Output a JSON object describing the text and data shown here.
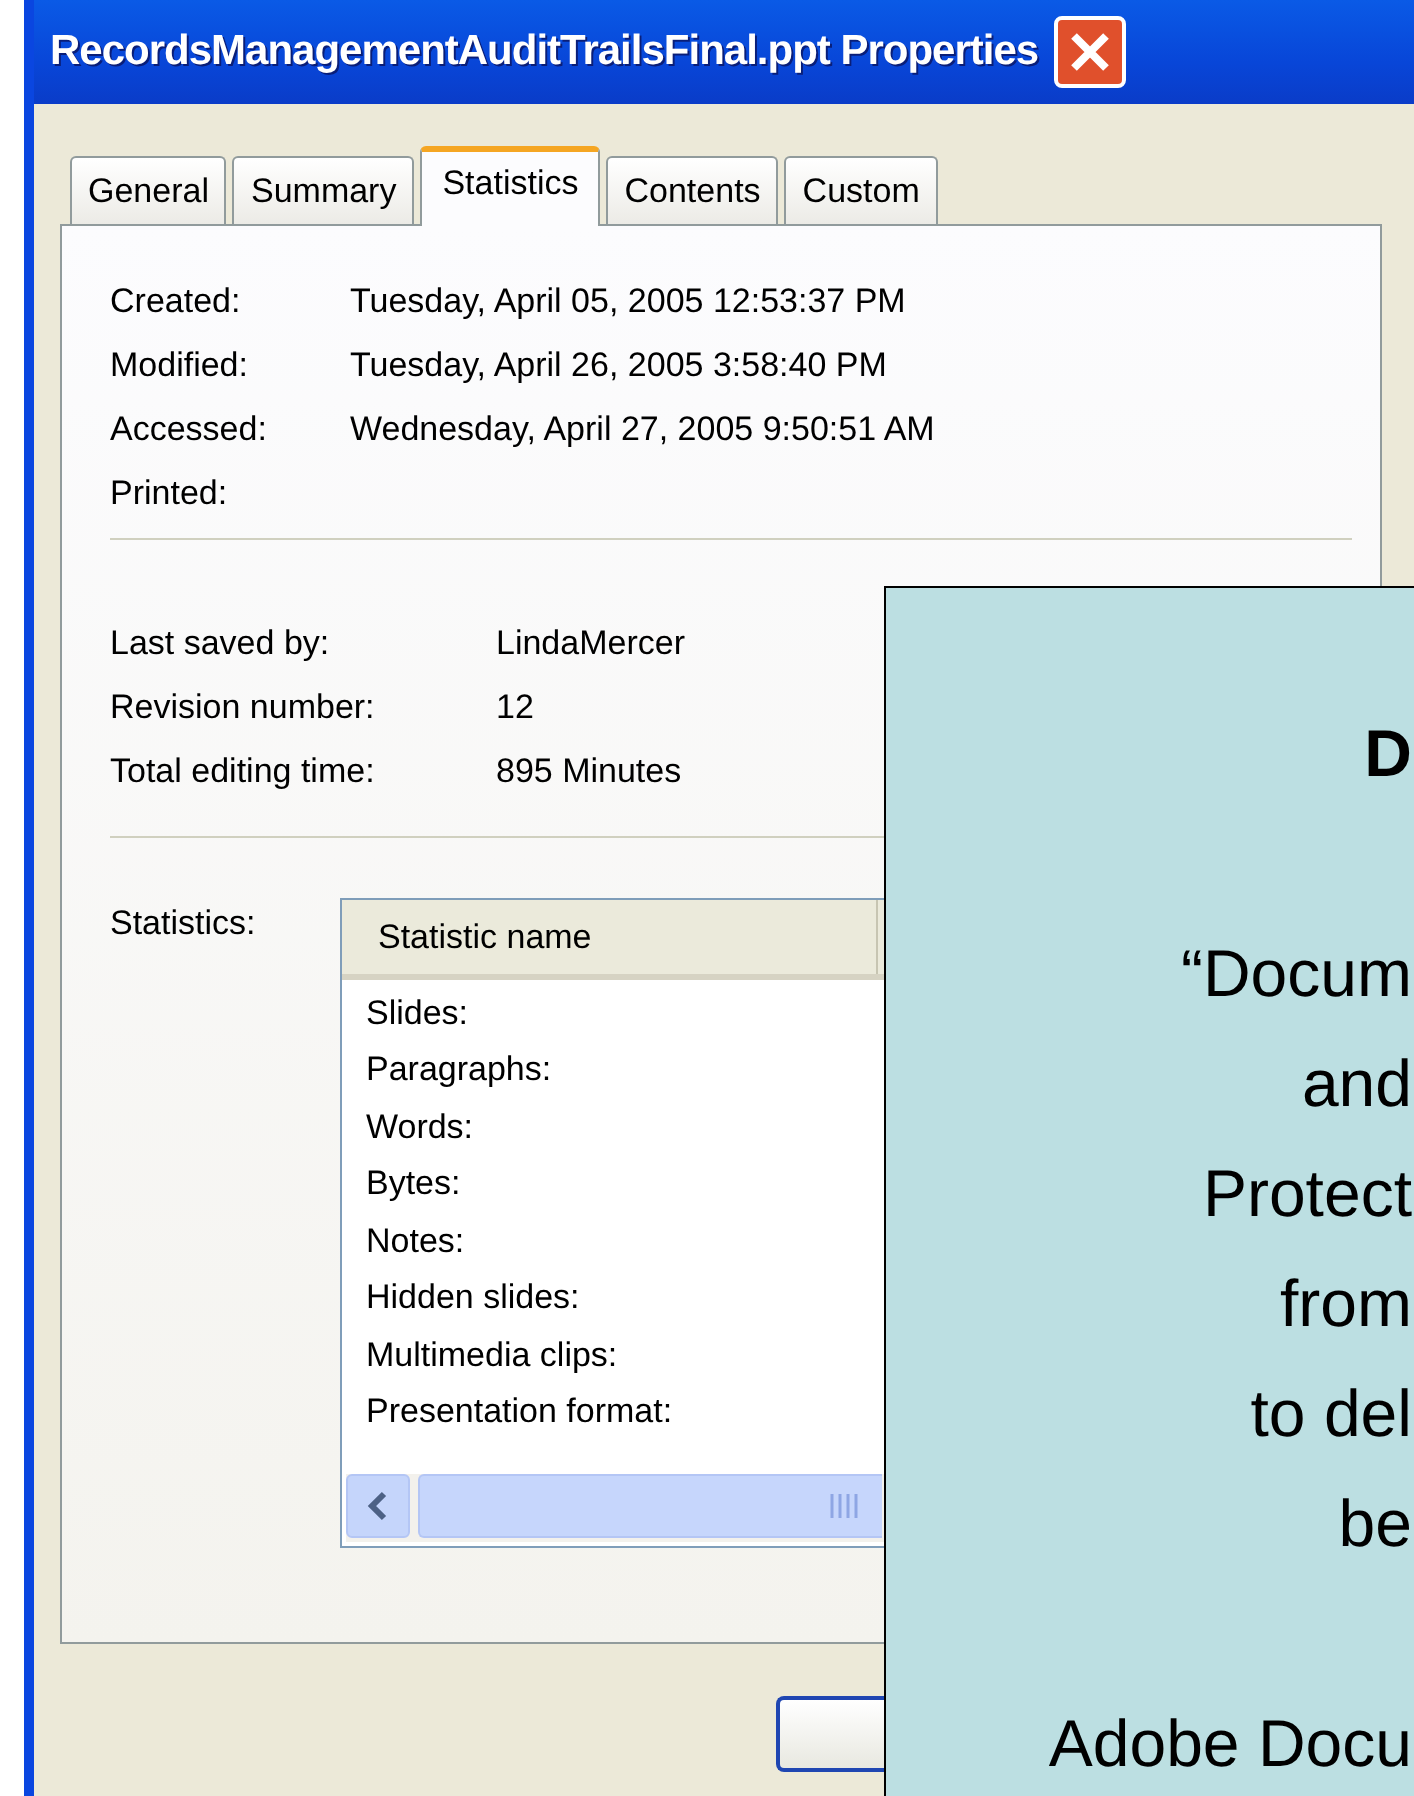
{
  "window": {
    "title": "RecordsManagementAuditTrailsFinal.ppt Properties"
  },
  "tabs": [
    {
      "label": "General",
      "selected": false
    },
    {
      "label": "Summary",
      "selected": false
    },
    {
      "label": "Statistics",
      "selected": true
    },
    {
      "label": "Contents",
      "selected": false
    },
    {
      "label": "Custom",
      "selected": false
    }
  ],
  "dates": [
    {
      "label": "Created:",
      "value": "Tuesday, April 05, 2005 12:53:37 PM"
    },
    {
      "label": "Modified:",
      "value": "Tuesday, April 26, 2005 3:58:40 PM"
    },
    {
      "label": "Accessed:",
      "value": "Wednesday, April 27, 2005 9:50:51 AM"
    },
    {
      "label": "Printed:"
    }
  ],
  "info": [
    {
      "label": "Last saved by:",
      "value": "LindaMercer"
    },
    {
      "label": "Revision number:",
      "value": "12"
    },
    {
      "label": "Total editing time:",
      "value": "895 Minutes"
    }
  ],
  "statistics": {
    "label": "Statistics:",
    "columns": [
      "Statistic name"
    ],
    "rows": [
      "Slides:",
      "Paragraphs:",
      "Words:",
      "Bytes:",
      "Notes:",
      "Hidden slides:",
      "Multimedia clips:",
      "Presentation format:"
    ]
  },
  "callout": {
    "paragraphs": [
      {
        "bold": true,
        "lines": [
          "D"
        ]
      },
      {
        "bold": false,
        "lines": [
          "“Docum",
          "and",
          "Protect",
          "from",
          "to del",
          "be"
        ]
      },
      {
        "bold": false,
        "lines": [
          "Adobe Docu"
        ]
      }
    ]
  }
}
